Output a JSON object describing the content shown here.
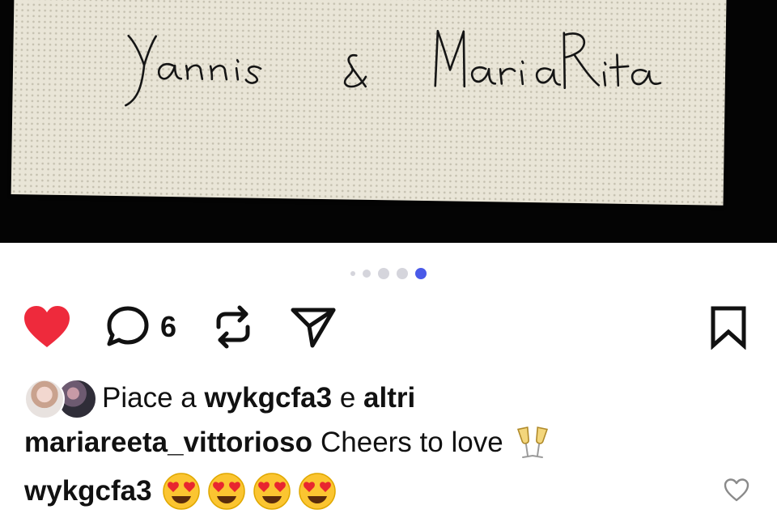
{
  "photo": {
    "signature_left": "Yannis",
    "signature_amp": "&",
    "signature_right": "MariaRita"
  },
  "carousel": {
    "slide_count": 5,
    "active_index": 4,
    "active_color": "#4a5ae8"
  },
  "actions": {
    "like_color": "#ee2a3c",
    "comment_count": "6"
  },
  "likes": {
    "prefix": "Piace a",
    "user": "wykgcfa3",
    "connector": "e",
    "others": "altri"
  },
  "caption": {
    "username": "mariareeta_vittorioso",
    "text": "Cheers to love",
    "emoji": "clinking-glasses"
  },
  "comment": {
    "username": "wykgcfa3",
    "emoji": [
      "heart-eyes",
      "heart-eyes",
      "heart-eyes",
      "heart-eyes"
    ]
  }
}
